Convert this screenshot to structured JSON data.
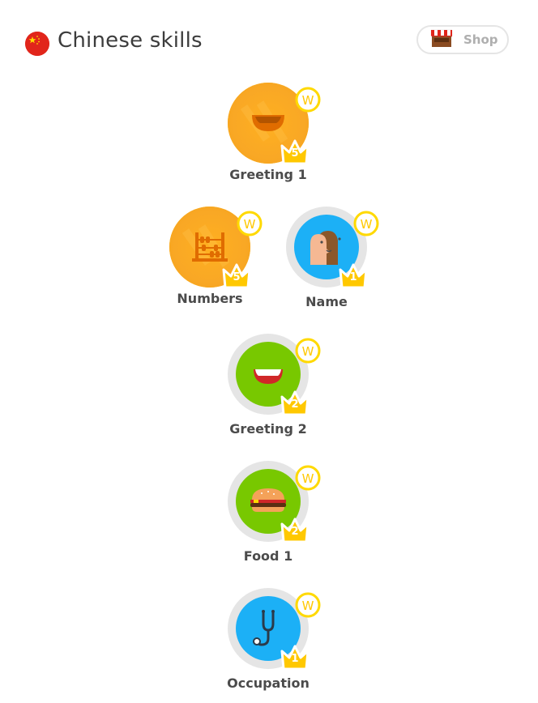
{
  "header": {
    "title": "Chinese skills",
    "shop_label": "Shop"
  },
  "skills": [
    {
      "label": "Greeting 1",
      "level": "5",
      "state": "gold",
      "icon": "mouth-icon"
    },
    {
      "label": "Numbers",
      "level": "5",
      "state": "gold",
      "icon": "abacus-icon"
    },
    {
      "label": "Name",
      "level": "1",
      "state": "blue",
      "icon": "people-icon"
    },
    {
      "label": "Greeting 2",
      "level": "2",
      "state": "green",
      "icon": "smile-icon"
    },
    {
      "label": "Food 1",
      "level": "2",
      "state": "green",
      "icon": "burger-icon"
    },
    {
      "label": "Occupation",
      "level": "1",
      "state": "blue",
      "icon": "stethoscope-icon"
    }
  ],
  "colors": {
    "gold": "#f9a825",
    "blue": "#1cb0f6",
    "green": "#78c800",
    "crown": "#ffc800",
    "ring": "#e5e5e5"
  }
}
